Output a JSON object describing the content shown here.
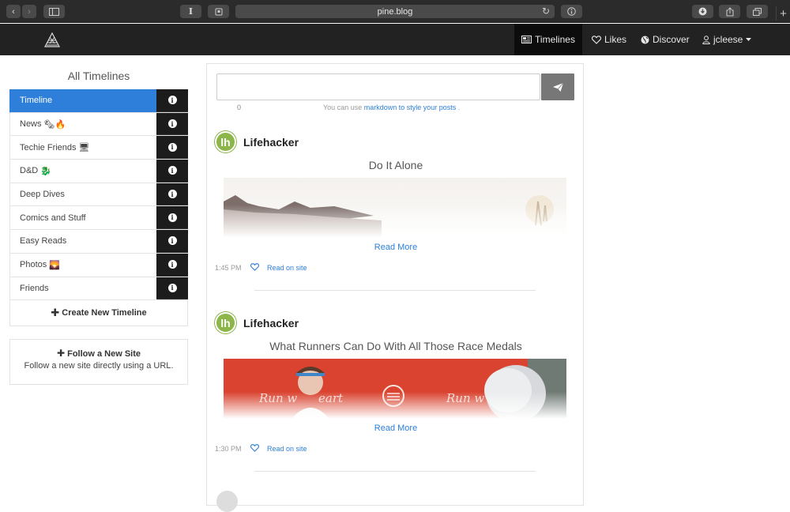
{
  "browser": {
    "url": "pine.blog"
  },
  "navbar": {
    "items": [
      {
        "label": "Timelines",
        "icon": "newspaper-icon",
        "active": true
      },
      {
        "label": "Likes",
        "icon": "heart-icon"
      },
      {
        "label": "Discover",
        "icon": "globe-icon"
      },
      {
        "label": "jcleese",
        "icon": "user-icon"
      }
    ]
  },
  "sidebar": {
    "title": "All Timelines",
    "timelines": [
      {
        "label": "Timeline",
        "emoji": ""
      },
      {
        "label": "News",
        "emoji": "🗞🔥"
      },
      {
        "label": "Techie Friends",
        "emoji": "🖥"
      },
      {
        "label": "D&D",
        "emoji": "🐉"
      },
      {
        "label": "Deep Dives",
        "emoji": ""
      },
      {
        "label": "Comics and Stuff",
        "emoji": ""
      },
      {
        "label": "Easy Reads",
        "emoji": ""
      },
      {
        "label": "Photos",
        "emoji": "🌄"
      },
      {
        "label": "Friends",
        "emoji": ""
      }
    ],
    "create_label": "Create New Timeline",
    "follow_title": "Follow a New Site",
    "follow_desc": "Follow a new site directly using a URL."
  },
  "compose": {
    "value": "",
    "char_count": "0",
    "hint_prefix": "You can use ",
    "hint_link": "markdown to style your posts",
    "hint_suffix": " ."
  },
  "posts": [
    {
      "author": "Lifehacker",
      "avatar_text": "lh",
      "title": "Do It Alone",
      "read_more": "Read More",
      "time": "1:45 PM",
      "read_on_site": "Read on site"
    },
    {
      "author": "Lifehacker",
      "avatar_text": "lh",
      "title": "What Runners Can Do With All Those Race Medals",
      "read_more": "Read More",
      "time": "1:30 PM",
      "read_on_site": "Read on site"
    }
  ],
  "colors": {
    "accent": "#2d7fd9",
    "navbar": "#222222",
    "avatar": "#8cb54a"
  }
}
